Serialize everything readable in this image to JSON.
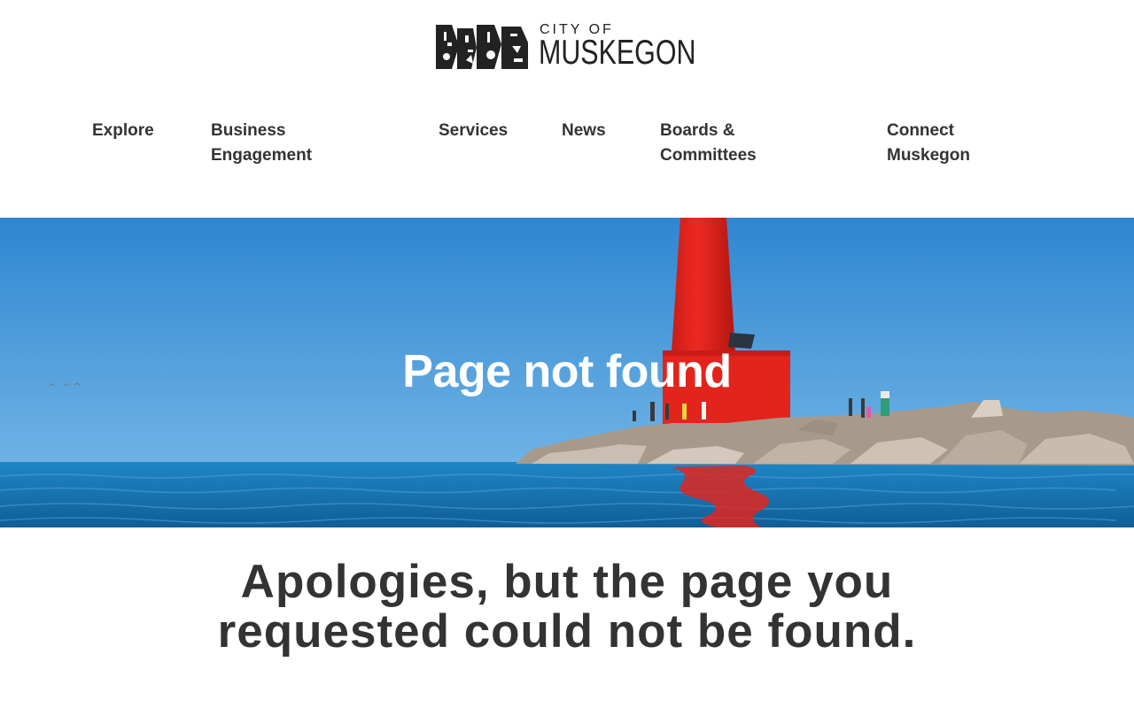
{
  "logo": {
    "small_text": "CITY OF",
    "big_text": "MUSKEGON",
    "colors": {
      "ink": "#222222"
    }
  },
  "nav": {
    "items": [
      {
        "line1": "Explore",
        "line2": ""
      },
      {
        "line1": "Business",
        "line2": "Engagement"
      },
      {
        "line1": "Services",
        "line2": ""
      },
      {
        "line1": "News",
        "line2": ""
      },
      {
        "line1": "Boards &",
        "line2": "Committees"
      },
      {
        "line1": "Connect",
        "line2": "Muskegon"
      }
    ]
  },
  "hero": {
    "title": "Page not found",
    "image_description_icon": "lighthouse-photo",
    "colors": {
      "sky": "#3d8fd1",
      "water": "#1a76b7",
      "lighthouse": "#e8261f",
      "rocks": "#b9aea1"
    }
  },
  "message": {
    "line1": "Apologies, but the page you",
    "line2": "requested could not be found."
  }
}
